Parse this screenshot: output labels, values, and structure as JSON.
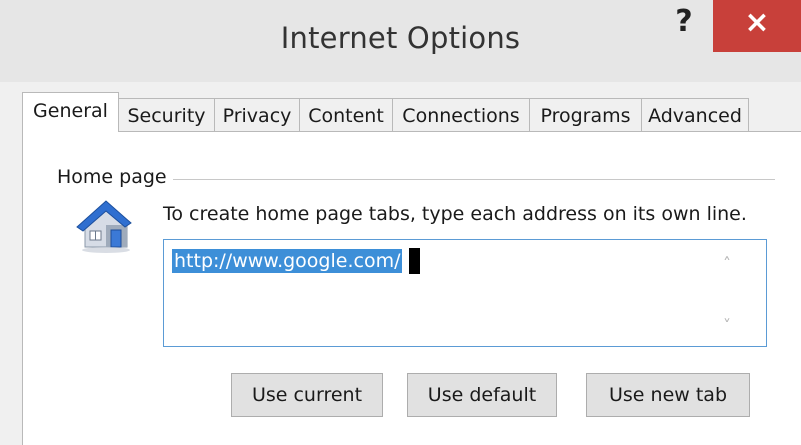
{
  "window": {
    "title": "Internet Options",
    "help_label": "?",
    "close_label": "×"
  },
  "tabs": [
    {
      "label": "General",
      "active": true
    },
    {
      "label": "Security",
      "active": false
    },
    {
      "label": "Privacy",
      "active": false
    },
    {
      "label": "Content",
      "active": false
    },
    {
      "label": "Connections",
      "active": false
    },
    {
      "label": "Programs",
      "active": false
    },
    {
      "label": "Advanced",
      "active": false
    }
  ],
  "home_page": {
    "legend": "Home page",
    "icon": "house-icon",
    "hint": "To create home page tabs, type each address on its own line.",
    "url": "http://www.google.com/",
    "buttons": {
      "use_current": "Use current",
      "use_default": "Use default",
      "use_new_tab": "Use new tab"
    }
  },
  "colors": {
    "close_button": "#c8403a",
    "selection": "#3d8fd8",
    "focus_border": "#5b9bd5"
  }
}
